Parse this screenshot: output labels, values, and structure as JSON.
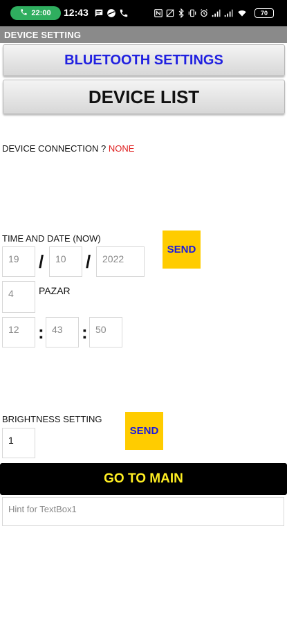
{
  "status_bar": {
    "call_time": "22:00",
    "clock": "12:43",
    "battery": "70",
    "icons": [
      "phone-icon",
      "message-icon",
      "app-icon",
      "call-icon",
      "nfc-icon",
      "sync-off-icon",
      "bluetooth-icon",
      "vibrate-icon",
      "alarm-icon",
      "signal-icon",
      "signal-icon",
      "wifi-icon",
      "battery-icon"
    ]
  },
  "title_bar": {
    "title": "DEVICE SETTING"
  },
  "buttons": {
    "bluetooth_settings": "BLUETOOTH SETTINGS",
    "device_list": "DEVICE LIST",
    "send_time": "SEND",
    "send_brightness": "SEND",
    "go_to_main": "GO TO MAIN"
  },
  "connection": {
    "label": "DEVICE CONNECTION ? ",
    "value": "NONE"
  },
  "time_date": {
    "label": "TIME AND DATE (NOW)",
    "day": "19",
    "month": "10",
    "year": "2022",
    "date_separator": "/",
    "weekday_number": "4",
    "weekday_name": "PAZAR",
    "hour": "12",
    "minute": "43",
    "second": "50",
    "time_separator": ":"
  },
  "brightness": {
    "label": "BRIGHTNESS SETTING",
    "value": "1"
  },
  "textbox1": {
    "placeholder": "Hint for TextBox1"
  },
  "colors": {
    "send_button": "#ffcc00",
    "go_main_background": "#000000",
    "go_main_text": "#ffee22",
    "bluetooth_label": "#2020e0",
    "connection_value": "#e02020"
  }
}
